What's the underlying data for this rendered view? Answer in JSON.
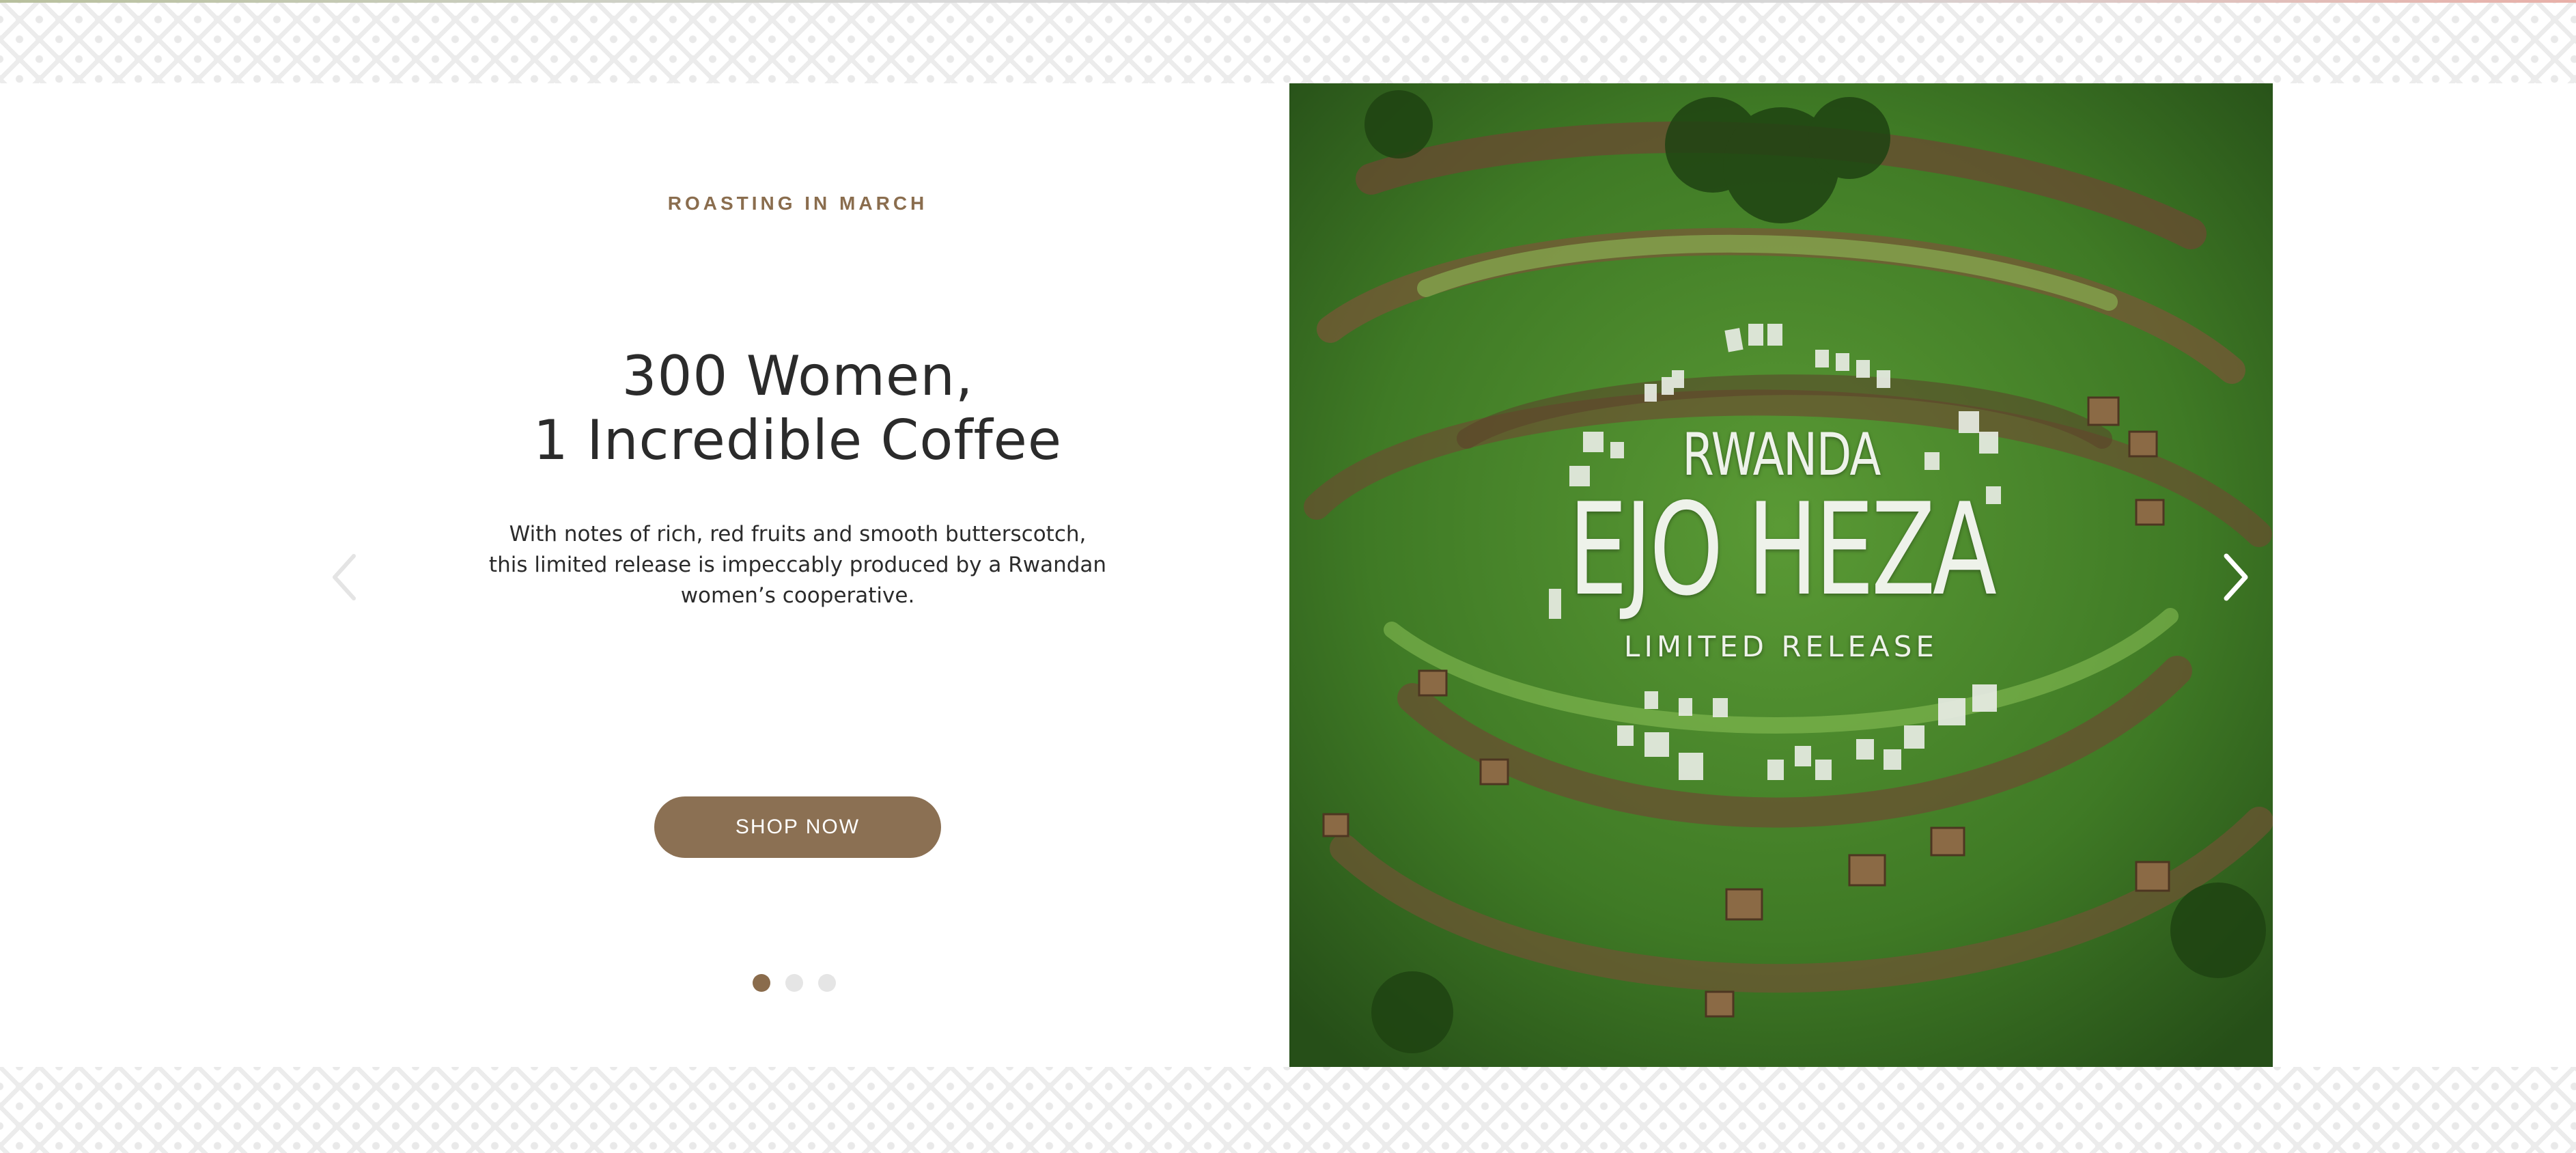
{
  "hero": {
    "eyebrow": "ROASTING IN MARCH",
    "headline_line1": "300 Women,",
    "headline_line2": "1 Incredible Coffee",
    "body_line1": "With notes of rich, red fruits and smooth butterscotch,",
    "body_line2": "this limited release is impeccably produced by a Rwandan",
    "body_line3": "women’s cooperative.",
    "cta_label": "SHOP NOW"
  },
  "image_overlay": {
    "country": "RWANDA",
    "name": "EJO HEZA",
    "release": "LIMITED RELEASE"
  },
  "carousel": {
    "slides": 3,
    "active_slide": 1,
    "prev_icon": "chevron-left-icon",
    "next_icon": "chevron-right-icon"
  },
  "colors": {
    "accent": "#8b7053",
    "eyebrow": "#8a6d4e",
    "text": "#2b2b2b",
    "dot_inactive": "#e5e5e5"
  }
}
